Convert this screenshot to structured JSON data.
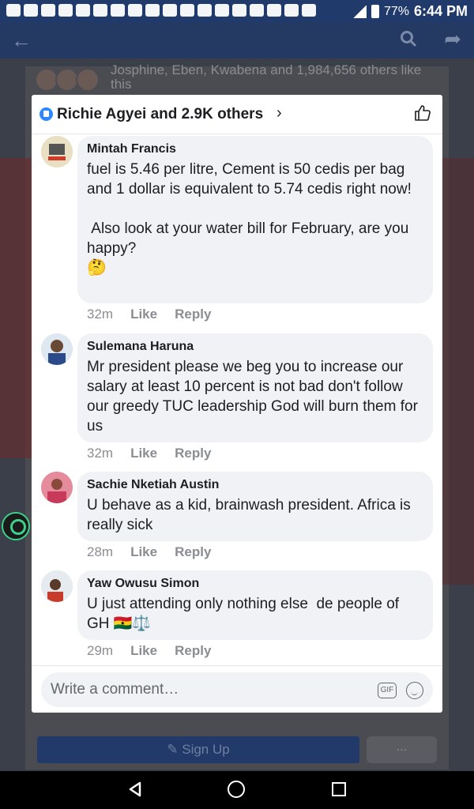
{
  "status_bar": {
    "battery": "77%",
    "time": "6:44 PM"
  },
  "background": {
    "likes_text": "Josphine, Eben, Kwabena and 1,984,656 others like this",
    "signup_label": "Sign Up",
    "more_label": "..."
  },
  "modal": {
    "title": "Richie Agyei and 2.9K others",
    "comments": [
      {
        "author": "Mintah Francis",
        "text": "fuel is 5.46 per litre, Cement is 50 cedis per bag and 1 dollar is equivalent to 5.74 cedis right now!\n\n Also look at your water bill for February, are you happy?",
        "emoji": "🤔",
        "time": "32m",
        "like": "Like",
        "reply": "Reply"
      },
      {
        "author": "Sulemana Haruna",
        "text": "Mr president please we beg you to increase our salary at least 10 percent is not bad don't follow our greedy TUC leadership God will burn them for us",
        "emoji": "",
        "time": "32m",
        "like": "Like",
        "reply": "Reply"
      },
      {
        "author": "Sachie Nketiah Austin",
        "text": "U behave as a kid, brainwash president. Africa is really sick",
        "emoji": "",
        "time": "28m",
        "like": "Like",
        "reply": "Reply"
      },
      {
        "author": "Yaw Owusu Simon",
        "text": "U just attending only nothing else  de people of GH 🇬🇭⚖️",
        "emoji": "",
        "time": "29m",
        "like": "Like",
        "reply": "Reply"
      }
    ],
    "composer": {
      "placeholder": "Write a comment…",
      "gif_label": "GIF"
    }
  }
}
